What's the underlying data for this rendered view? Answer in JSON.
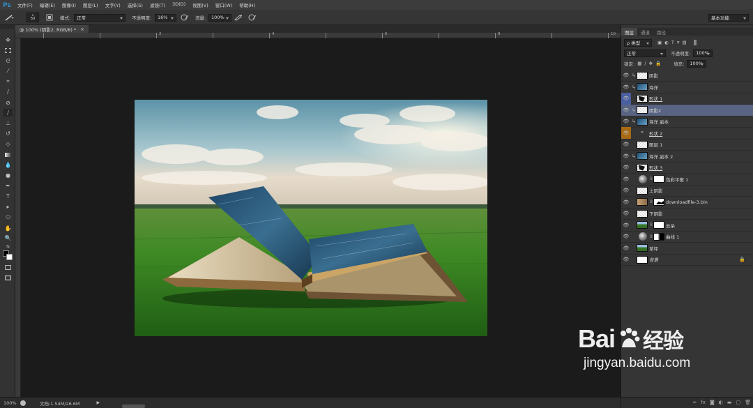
{
  "app": {
    "logo": "Ps"
  },
  "menu": [
    "文件(F)",
    "编辑(E)",
    "图像(I)",
    "图层(L)",
    "文字(Y)",
    "选择(S)",
    "滤镜(T)",
    "3D(D)",
    "视图(V)",
    "窗口(W)",
    "帮助(H)"
  ],
  "options": {
    "brush_size": "50",
    "mode_label": "模式:",
    "mode_value": "正常",
    "opacity_label": "不透明度:",
    "opacity_value": "16%",
    "flow_label": "流量:",
    "flow_value": "100%",
    "workspace": "基本功能"
  },
  "document_tab": {
    "title": "@ 100% (阴影2, RGB/8) *",
    "close": "×"
  },
  "ruler_numbers": [
    "2",
    "4",
    "6",
    "8",
    "10"
  ],
  "status": {
    "zoom": "100%",
    "doc_info": "文档:1.54M/26.6M"
  },
  "panel": {
    "tabs": [
      "图层",
      "通道",
      "路径"
    ],
    "filter_label": "ρ 类型",
    "blend_mode": "正常",
    "opacity_label": "不透明度:",
    "opacity_value": "100%",
    "lock_label": "锁定:",
    "fill_label": "填充:",
    "fill_value": "100%"
  },
  "layers": [
    {
      "name": "阴影",
      "thumb": "chk",
      "clip": true,
      "underline": false,
      "selected": false,
      "eye_color": ""
    },
    {
      "name": "海洋",
      "thumb": "sea",
      "clip": true,
      "underline": false,
      "selected": false,
      "eye_color": ""
    },
    {
      "name": "形状 1",
      "thumb": "shape",
      "clip": false,
      "underline": true,
      "selected": false,
      "eye_color": "#4a5fa0"
    },
    {
      "name": "阴影2",
      "thumb": "chk",
      "clip": true,
      "underline": false,
      "selected": true,
      "eye_color": ""
    },
    {
      "name": "海洋 副本",
      "thumb": "sea",
      "clip": true,
      "underline": false,
      "selected": false,
      "eye_color": ""
    },
    {
      "name": "形状 2",
      "thumb": "none",
      "clip": false,
      "underline": true,
      "selected": false,
      "eye_color": "#a86a12"
    },
    {
      "name": "图层 1",
      "thumb": "chk",
      "clip": false,
      "underline": false,
      "selected": false,
      "eye_color": ""
    },
    {
      "name": "海洋 副本 2",
      "thumb": "sea",
      "clip": true,
      "underline": false,
      "selected": false,
      "eye_color": ""
    },
    {
      "name": "形状 3",
      "thumb": "shape",
      "clip": false,
      "underline": true,
      "selected": false,
      "eye_color": ""
    },
    {
      "name": "色彩平衡 1",
      "thumb": "adj-white",
      "clip": false,
      "underline": false,
      "selected": false,
      "eye_color": ""
    },
    {
      "name": "上阴影",
      "thumb": "chk",
      "clip": false,
      "underline": false,
      "selected": false,
      "eye_color": ""
    },
    {
      "name": "downloadfile-3.bin",
      "thumb": "photo-mask",
      "clip": false,
      "underline": false,
      "selected": false,
      "eye_color": ""
    },
    {
      "name": "下阴影",
      "thumb": "chk",
      "clip": false,
      "underline": false,
      "selected": false,
      "eye_color": ""
    },
    {
      "name": "云朵",
      "thumb": "grass-mask",
      "clip": false,
      "underline": false,
      "selected": false,
      "eye_color": ""
    },
    {
      "name": "曲线 1",
      "thumb": "adj-curve",
      "clip": false,
      "underline": false,
      "selected": false,
      "eye_color": ""
    },
    {
      "name": "草坪",
      "thumb": "grass",
      "clip": false,
      "underline": false,
      "selected": false,
      "eye_color": ""
    },
    {
      "name": "背景",
      "thumb": "w",
      "clip": false,
      "underline": false,
      "selected": false,
      "eye_color": "",
      "italic": true,
      "locked": true
    }
  ],
  "watermark": {
    "brand": "Bai",
    "brand2": "经验",
    "url": "jingyan.baidu.com"
  }
}
